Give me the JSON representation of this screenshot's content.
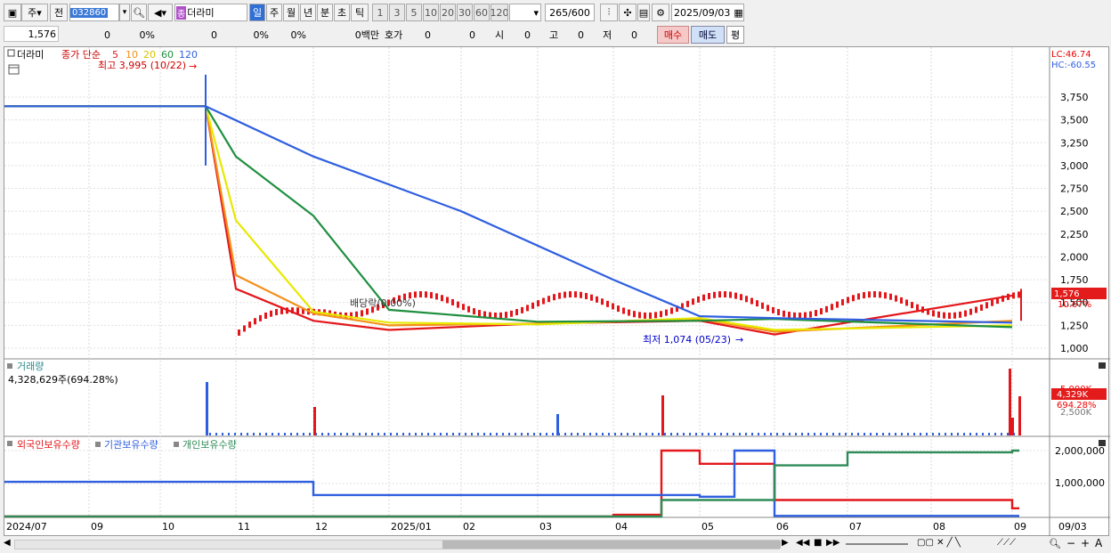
{
  "toolbar": {
    "period_select": "주",
    "prev_label": "전",
    "stock_code": "032860",
    "stock_tag": "종",
    "stock_name": "더라미",
    "tf_day": "일",
    "tf_week": "주",
    "tf_month": "월",
    "tf_year": "년",
    "tf_minute": "분",
    "tf_second": "초",
    "tf_tick": "틱",
    "intervals": [
      "1",
      "3",
      "5",
      "10",
      "20",
      "30",
      "60",
      "120"
    ],
    "count_value": "265",
    "count_total": "/600",
    "date_value": "2025/09/03"
  },
  "infobar": {
    "price": "1,576",
    "change": "0",
    "change_pct": "0%",
    "volume": "0",
    "rate1": "0%",
    "rate2": "0%",
    "amount": "0백만",
    "hoga_label": "호가",
    "hoga1": "0",
    "hoga2": "0",
    "si_label": "시",
    "si_value": "0",
    "go_label": "고",
    "go_value": "0",
    "jeo_label": "저",
    "jeo_value": "0",
    "buy_label": "매수",
    "sell_label": "매도",
    "pyeong_label": "평"
  },
  "price_panel": {
    "stock_label": "더라미",
    "legend_prefix": "종가 단순",
    "ma_labels": [
      "5",
      "10",
      "20",
      "60",
      "120"
    ],
    "ma_colors": [
      "#e3171b",
      "#f39019",
      "#e8e800",
      "#1f8f3f",
      "#2f5fe0"
    ],
    "high_label": "최고 3,995 (10/22)",
    "low_label": "최저 1,074 (05/23)",
    "dividend_label": "배당락(0.00%)",
    "lc_label": "LC:46.74",
    "hc_label": "HC:-60.55",
    "current_price_label": "1,576",
    "current_pct_label": "10.67%",
    "y_ticks": [
      "3,750",
      "3,500",
      "3,250",
      "3,000",
      "2,750",
      "2,500",
      "2,250",
      "2,000",
      "1,750",
      "1,500",
      "1,250",
      "1,000"
    ]
  },
  "volume_panel": {
    "title": "거래량",
    "value_label": "4,328,629주(694.28%)",
    "y_tick": "5,000K",
    "y_tick_low": "2,500K",
    "current_label": "4,329K",
    "current_pct": "694.28%"
  },
  "holding_panel": {
    "series_labels": [
      "외국인보유수량",
      "기관보유수량",
      "개인보유수량"
    ],
    "series_colors": [
      "#e3171b",
      "#2f5fe0",
      "#2e8b57"
    ],
    "y_ticks": [
      "2,000,000",
      "1,000,000"
    ]
  },
  "x_axis": {
    "labels": [
      "2024/07",
      "09",
      "10",
      "11",
      "12",
      "2025/01",
      "02",
      "03",
      "04",
      "05",
      "06",
      "07",
      "08",
      "09"
    ],
    "right_label": "09/03"
  },
  "chart_data": {
    "type": "line",
    "price_ma_lines": [
      {
        "name": "5",
        "color": "#e3171b",
        "x": [
          "2024/10/22",
          "2024/11",
          "2024/12",
          "2025/01",
          "2025/03",
          "2025/05",
          "2025/06",
          "2025/09"
        ],
        "values": [
          3650,
          1650,
          1300,
          1200,
          1270,
          1300,
          1150,
          1576
        ]
      },
      {
        "name": "10",
        "color": "#f39019",
        "x": [
          "2024/10/22",
          "2024/11",
          "2024/12",
          "2025/01",
          "2025/03",
          "2025/05",
          "2025/06",
          "2025/09"
        ],
        "values": [
          3650,
          1800,
          1380,
          1250,
          1270,
          1320,
          1180,
          1300
        ]
      },
      {
        "name": "20",
        "color": "#e8e800",
        "x": [
          "2024/10/22",
          "2024/11",
          "2024/12",
          "2025/01",
          "2025/03",
          "2025/05",
          "2025/06",
          "2025/09"
        ],
        "values": [
          3650,
          2400,
          1400,
          1280,
          1260,
          1330,
          1200,
          1250
        ]
      },
      {
        "name": "60",
        "color": "#1f8f3f",
        "x": [
          "2024/10/22",
          "2024/11",
          "2024/12",
          "2025/01",
          "2025/03",
          "2025/05",
          "2025/06",
          "2025/09"
        ],
        "values": [
          3650,
          3100,
          2450,
          1420,
          1290,
          1300,
          1320,
          1230
        ]
      },
      {
        "name": "120",
        "color": "#2f5fe0",
        "x": [
          "2024/07",
          "2024/10/22",
          "2024/12",
          "2025/02",
          "2025/04",
          "2025/05",
          "2025/06",
          "2025/09"
        ],
        "values": [
          3650,
          3650,
          3100,
          2500,
          1750,
          1350,
          1330,
          1280
        ]
      }
    ],
    "holdings": [
      {
        "name": "외국인보유수량",
        "x": [
          "2024/07",
          "2025/04",
          "2025/04/20",
          "2025/05",
          "2025/06",
          "2025/09"
        ],
        "values": [
          0,
          50000,
          2000000,
          1600000,
          500000,
          250000
        ]
      },
      {
        "name": "기관보유수량",
        "x": [
          "2024/07",
          "2024/11",
          "2024/12",
          "2025/05",
          "2025/05/20",
          "2025/06",
          "2025/09"
        ],
        "values": [
          1050000,
          1050000,
          650000,
          600000,
          2000000,
          20000,
          20000
        ]
      },
      {
        "name": "개인보유수량",
        "x": [
          "2024/07",
          "2025/03",
          "2025/04/20",
          "2025/06",
          "2025/07",
          "2025/09"
        ],
        "values": [
          0,
          0,
          500000,
          1550000,
          1950000,
          2000000
        ]
      }
    ],
    "ylim_price": [
      900,
      3900
    ],
    "ylim_holding": [
      0,
      2100000
    ]
  }
}
